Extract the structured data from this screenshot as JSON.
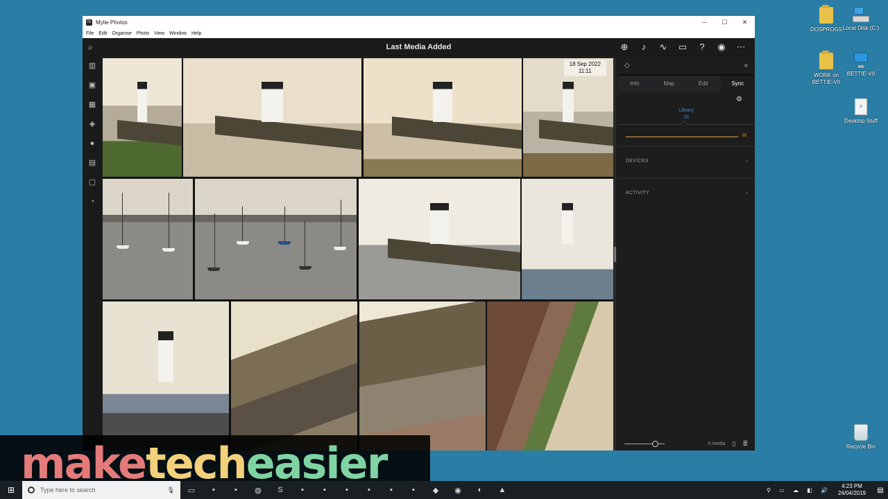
{
  "desktop": {
    "icons": [
      {
        "label": "DOSPROGS",
        "icon": "folder-icon"
      },
      {
        "label": "Local Disk (C:)",
        "icon": "drive-icon"
      },
      {
        "label": "WORK on BETTIE-VII",
        "icon": "shortcut-folder-icon"
      },
      {
        "label": "BETTIE-VII",
        "icon": "computer-icon"
      },
      {
        "label": "Desktop Stuff",
        "icon": "document-icon"
      },
      {
        "label": "Recycle Bin",
        "icon": "recycle-bin-icon"
      }
    ]
  },
  "app": {
    "title": "Mylie Photos",
    "menu": [
      "File",
      "Edit",
      "Organise",
      "Photo",
      "View",
      "Window",
      "Help"
    ],
    "toolbar_title": "Last Media Added",
    "date_badge": {
      "date": "18 Sep 2022",
      "time": "11:11"
    },
    "tabs": [
      "Info",
      "Map",
      "Edit",
      "Sync"
    ],
    "active_tab": "Sync",
    "library": {
      "label": "Library",
      "count": "29",
      "bar_value": "29"
    },
    "sections": [
      "DEVICES",
      "ACTIVITY"
    ],
    "footer_media": "0 media"
  },
  "watermark": {
    "parts": [
      "make",
      "tech",
      "easier"
    ],
    "colors": [
      "#e57a7a",
      "#f2d17a",
      "#7fd3a3"
    ]
  },
  "taskbar": {
    "search_placeholder": "Type here to search",
    "time": "4:23 PM",
    "date": "24/04/2019"
  }
}
